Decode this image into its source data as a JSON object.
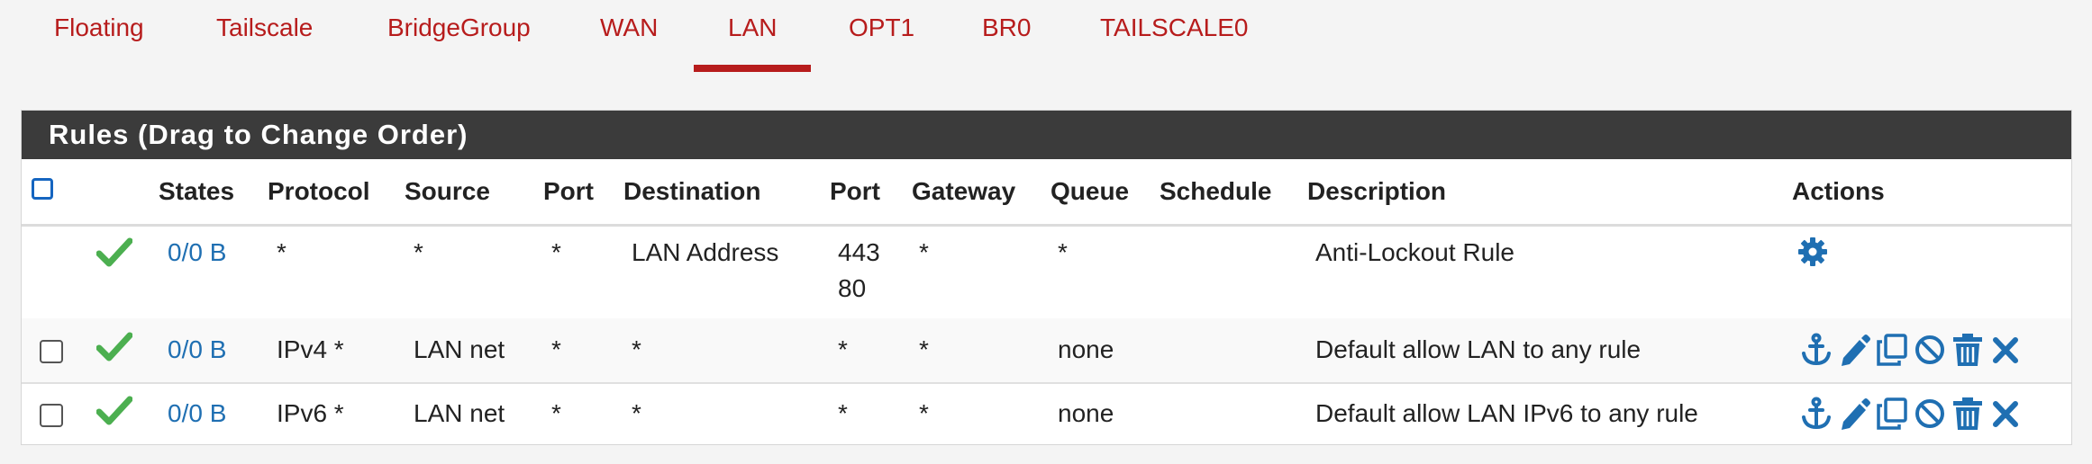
{
  "tabs": [
    {
      "label": "Floating"
    },
    {
      "label": "Tailscale"
    },
    {
      "label": "BridgeGroup"
    },
    {
      "label": "WAN"
    },
    {
      "label": "LAN",
      "active": true
    },
    {
      "label": "OPT1"
    },
    {
      "label": "BR0"
    },
    {
      "label": "TAILSCALE0"
    }
  ],
  "panel": {
    "title": "Rules (Drag to Change Order)"
  },
  "columns": {
    "states": "States",
    "protocol": "Protocol",
    "source": "Source",
    "port": "Port",
    "destination": "Destination",
    "dest_port": "Port",
    "gateway": "Gateway",
    "queue": "Queue",
    "schedule": "Schedule",
    "description": "Description",
    "actions": "Actions"
  },
  "rules": [
    {
      "states": "0/0 B",
      "protocol": "*",
      "source": "*",
      "port": "*",
      "destination": "LAN Address",
      "dest_port_1": "443",
      "dest_port_2": "80",
      "gateway": "*",
      "queue": "*",
      "schedule": "",
      "description": "Anti-Lockout Rule"
    },
    {
      "states": "0/0 B",
      "protocol": "IPv4 *",
      "source": "LAN net",
      "port": "*",
      "destination": "*",
      "dest_port": "*",
      "gateway": "*",
      "queue": "none",
      "schedule": "",
      "description": "Default allow LAN to any rule"
    },
    {
      "states": "0/0 B",
      "protocol": "IPv6 *",
      "source": "LAN net",
      "port": "*",
      "destination": "*",
      "dest_port": "*",
      "gateway": "*",
      "queue": "none",
      "schedule": "",
      "description": "Default allow LAN IPv6 to any rule"
    }
  ],
  "colors": {
    "accent": "#b71c1c",
    "link": "#1f6fb2",
    "pass": "#4caf50",
    "heading": "#3b3b3b"
  }
}
